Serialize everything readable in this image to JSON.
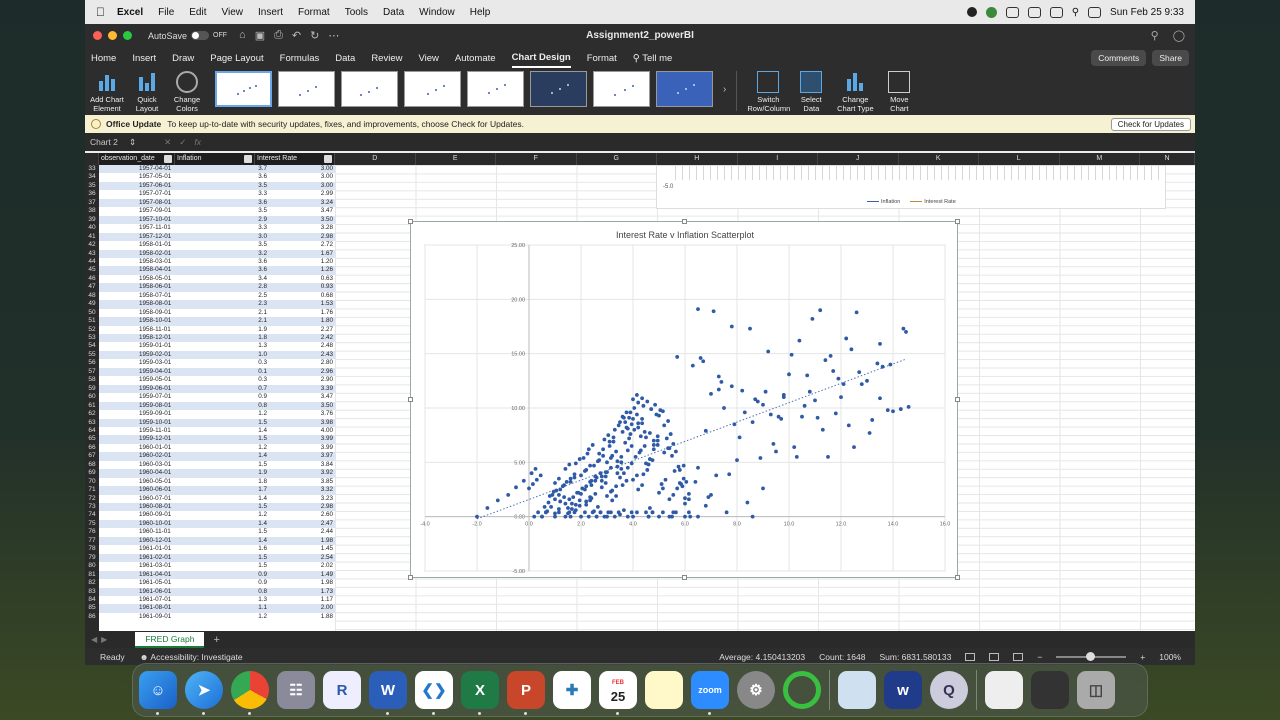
{
  "menubar": {
    "app": "Excel",
    "items": [
      "File",
      "Edit",
      "View",
      "Insert",
      "Format",
      "Tools",
      "Data",
      "Window",
      "Help"
    ],
    "clock": "Sun Feb 25  9:33"
  },
  "titlebar": {
    "autosave_label": "AutoSave",
    "autosave_state": "OFF",
    "title": "Assignment2_powerBI"
  },
  "ribbon_tabs": [
    "Home",
    "Insert",
    "Draw",
    "Page Layout",
    "Formulas",
    "Data",
    "Review",
    "View",
    "Automate",
    "Chart Design",
    "Format"
  ],
  "active_tab": "Chart Design",
  "tell_me": "Tell me",
  "comments_label": "Comments",
  "share_label": "Share",
  "ribbon": {
    "add_chart_element": "Add Chart Element",
    "quick_layout": "Quick Layout",
    "change_colors": "Change Colors",
    "switch_row_column": "Switch Row/Column",
    "select_data": "Select Data",
    "change_chart_type": "Change Chart Type",
    "move_chart": "Move Chart"
  },
  "notification": {
    "title": "Office Update",
    "message": "To keep up-to-date with security updates, fixes, and improvements, choose Check for Updates.",
    "button": "Check for Updates"
  },
  "formula_bar": {
    "name_box": "Chart 2",
    "fx": "fx"
  },
  "columns": {
    "headers": [
      "observation_date",
      "Inflation",
      "Interest Rate",
      "D",
      "E",
      "F",
      "G",
      "H",
      "I",
      "J",
      "K",
      "L",
      "M",
      "N"
    ]
  },
  "table": {
    "start_row": 33,
    "rows": [
      [
        "1957-04-01",
        "3.7",
        "3.00"
      ],
      [
        "1957-05-01",
        "3.6",
        "3.00"
      ],
      [
        "1957-06-01",
        "3.5",
        "3.00"
      ],
      [
        "1957-07-01",
        "3.3",
        "2.99"
      ],
      [
        "1957-08-01",
        "3.6",
        "3.24"
      ],
      [
        "1957-09-01",
        "3.5",
        "3.47"
      ],
      [
        "1957-10-01",
        "2.9",
        "3.50"
      ],
      [
        "1957-11-01",
        "3.3",
        "3.28"
      ],
      [
        "1957-12-01",
        "3.0",
        "2.98"
      ],
      [
        "1958-01-01",
        "3.5",
        "2.72"
      ],
      [
        "1958-02-01",
        "3.2",
        "1.67"
      ],
      [
        "1958-03-01",
        "3.6",
        "1.20"
      ],
      [
        "1958-04-01",
        "3.6",
        "1.26"
      ],
      [
        "1958-05-01",
        "3.4",
        "0.63"
      ],
      [
        "1958-06-01",
        "2.8",
        "0.93"
      ],
      [
        "1958-07-01",
        "2.5",
        "0.68"
      ],
      [
        "1958-08-01",
        "2.3",
        "1.53"
      ],
      [
        "1958-09-01",
        "2.1",
        "1.76"
      ],
      [
        "1958-10-01",
        "2.1",
        "1.80"
      ],
      [
        "1958-11-01",
        "1.9",
        "2.27"
      ],
      [
        "1958-12-01",
        "1.8",
        "2.42"
      ],
      [
        "1959-01-01",
        "1.3",
        "2.48"
      ],
      [
        "1959-02-01",
        "1.0",
        "2.43"
      ],
      [
        "1959-03-01",
        "0.3",
        "2.80"
      ],
      [
        "1959-04-01",
        "0.1",
        "2.96"
      ],
      [
        "1959-05-01",
        "0.3",
        "2.90"
      ],
      [
        "1959-06-01",
        "0.7",
        "3.39"
      ],
      [
        "1959-07-01",
        "0.9",
        "3.47"
      ],
      [
        "1959-08-01",
        "0.8",
        "3.50"
      ],
      [
        "1959-09-01",
        "1.2",
        "3.76"
      ],
      [
        "1959-10-01",
        "1.5",
        "3.98"
      ],
      [
        "1959-11-01",
        "1.4",
        "4.00"
      ],
      [
        "1959-12-01",
        "1.5",
        "3.99"
      ],
      [
        "1960-01-01",
        "1.2",
        "3.99"
      ],
      [
        "1960-02-01",
        "1.4",
        "3.97"
      ],
      [
        "1960-03-01",
        "1.5",
        "3.84"
      ],
      [
        "1960-04-01",
        "1.9",
        "3.92"
      ],
      [
        "1960-05-01",
        "1.8",
        "3.85"
      ],
      [
        "1960-06-01",
        "1.7",
        "3.32"
      ],
      [
        "1960-07-01",
        "1.4",
        "3.23"
      ],
      [
        "1960-08-01",
        "1.5",
        "2.98"
      ],
      [
        "1960-09-01",
        "1.2",
        "2.60"
      ],
      [
        "1960-10-01",
        "1.4",
        "2.47"
      ],
      [
        "1960-11-01",
        "1.5",
        "2.44"
      ],
      [
        "1960-12-01",
        "1.4",
        "1.98"
      ],
      [
        "1961-01-01",
        "1.6",
        "1.45"
      ],
      [
        "1961-02-01",
        "1.5",
        "2.54"
      ],
      [
        "1961-03-01",
        "1.5",
        "2.02"
      ],
      [
        "1961-04-01",
        "0.9",
        "1.49"
      ],
      [
        "1961-05-01",
        "0.9",
        "1.98"
      ],
      [
        "1961-06-01",
        "0.8",
        "1.73"
      ],
      [
        "1961-07-01",
        "1.3",
        "1.17"
      ],
      [
        "1961-08-01",
        "1.1",
        "2.00"
      ],
      [
        "1961-09-01",
        "1.2",
        "1.88"
      ]
    ]
  },
  "line_chart_partial": {
    "y_tick": "-5.0",
    "legend": [
      "Inflation",
      "Interest Rate"
    ]
  },
  "chart_data": {
    "type": "scatter",
    "title": "Interest Rate v Inflation Scatterplot",
    "xlim": [
      -4,
      16
    ],
    "ylim": [
      -5,
      25
    ],
    "x_ticks": [
      "-4.0",
      "-2.0",
      "0.0",
      "2.0",
      "4.0",
      "6.0",
      "8.0",
      "10.0",
      "12.0",
      "14.0",
      "16.0"
    ],
    "y_ticks": [
      "-5.00",
      "0.00",
      "5.00",
      "10.00",
      "15.00",
      "20.00",
      "25.00"
    ],
    "trendline": {
      "style": "dotted linear",
      "from": [
        -2,
        -0.2
      ],
      "to": [
        14.5,
        14.5
      ]
    },
    "points_x": [
      -2.0,
      -1.6,
      -1.2,
      -0.8,
      -0.5,
      -0.2,
      0.0,
      0.1,
      0.3,
      0.5,
      0.7,
      0.9,
      1.0,
      1.2,
      1.3,
      1.4,
      1.5,
      1.6,
      1.7,
      1.8,
      1.9,
      2.0,
      2.1,
      2.2,
      2.3,
      2.4,
      2.5,
      2.6,
      2.7,
      2.8,
      2.9,
      3.0,
      3.1,
      3.2,
      3.3,
      3.4,
      3.5,
      3.6,
      3.7,
      3.8,
      3.9,
      4.0,
      4.1,
      4.2,
      4.3,
      4.4,
      4.5,
      4.6,
      4.8,
      5.0,
      5.2,
      5.4,
      5.6,
      5.8,
      6.0,
      6.2,
      6.5,
      6.8,
      7.2,
      7.6,
      8.0,
      8.4,
      0.5,
      0.8,
      1.0,
      1.2,
      1.4,
      1.6,
      1.8,
      2.0,
      2.2,
      2.4,
      2.6,
      2.8,
      3.0,
      3.2,
      3.4,
      3.6,
      3.8,
      4.0,
      4.2,
      4.5,
      4.8,
      5.1,
      5.4,
      5.7,
      6.0,
      0.2,
      0.6,
      1.0,
      1.4,
      1.8,
      2.2,
      2.6,
      3.0,
      3.4,
      3.8,
      4.2,
      4.6,
      5.0,
      5.4,
      2.4,
      2.7,
      3.1,
      3.5,
      3.9,
      4.3,
      4.7,
      5.2,
      5.8,
      3.2,
      3.6,
      4.0,
      4.4,
      4.8,
      3.8,
      4.2,
      4.6,
      1.5,
      2.0,
      2.5,
      3.0,
      3.5,
      4.0,
      4.5,
      5.0,
      5.5,
      6.0,
      6.5,
      7.0,
      2.2,
      2.8,
      3.3,
      1.0,
      1.6,
      2.3,
      2.9,
      3.7,
      4.9,
      5.3,
      5.7,
      6.3,
      6.7,
      7.3,
      7.8,
      8.3,
      8.8,
      9.2,
      9.6,
      10.0,
      10.4,
      10.8,
      11.2,
      11.6,
      12.0,
      12.4,
      12.8,
      13.2,
      13.6,
      14.0,
      14.4,
      10.2,
      10.6,
      11.0,
      11.4,
      11.8,
      12.2,
      12.6,
      13.0,
      13.4,
      13.8,
      6.6,
      7.0,
      7.4,
      7.8,
      8.2,
      8.6,
      9.0,
      9.4,
      9.8,
      10.3,
      10.7,
      11.1,
      11.5,
      11.9,
      12.3,
      12.7,
      13.1,
      13.5,
      13.9,
      14.3,
      14.5,
      14.6,
      9.8,
      10.5,
      11.3,
      12.5,
      13.5,
      6.5,
      7.1,
      7.5,
      8.5,
      9.1,
      9.7,
      10.1,
      10.9,
      11.7,
      12.1,
      6.8,
      7.3,
      7.9,
      8.7,
      9.3,
      8.1,
      8.9,
      9.5,
      5.5,
      5.9,
      6.4,
      6.9,
      7.7,
      8.6,
      9.0
    ],
    "points_y": [
      0.0,
      0.8,
      1.5,
      2.0,
      2.7,
      3.3,
      2.6,
      4.0,
      3.4,
      0.0,
      0.5,
      2.0,
      3.1,
      1.4,
      2.8,
      4.4,
      0.8,
      3.5,
      1.8,
      4.9,
      2.2,
      3.8,
      5.4,
      1.1,
      6.2,
      2.9,
      4.7,
      0.0,
      5.8,
      3.3,
      7.1,
      4.1,
      6.5,
      2.4,
      8.0,
      5.1,
      3.6,
      9.2,
      6.8,
      4.5,
      7.6,
      10.8,
      5.5,
      8.6,
      6.1,
      3.9,
      7.3,
      4.8,
      6.6,
      2.2,
      5.9,
      1.6,
      4.2,
      3.1,
      1.7,
      0.0,
      4.5,
      1.0,
      3.8,
      0.4,
      5.2,
      1.3,
      0.0,
      1.9,
      0.3,
      2.5,
      1.2,
      3.2,
      0.6,
      2.1,
      4.3,
      1.7,
      3.6,
      2.7,
      5.0,
      1.5,
      4.0,
      2.9,
      6.1,
      3.4,
      8.2,
      4.9,
      7.0,
      3.0,
      6.3,
      2.6,
      1.2,
      0.0,
      0.9,
      1.6,
      0.0,
      1.1,
      2.8,
      0.0,
      1.9,
      4.6,
      0.0,
      2.5,
      0.0,
      9.3,
      0.0,
      3.3,
      5.2,
      6.9,
      8.7,
      9.6,
      7.4,
      9.9,
      8.4,
      4.3,
      5.6,
      7.8,
      9.0,
      10.2,
      6.2,
      8.1,
      10.5,
      0.0,
      0.3,
      0.0,
      0.5,
      0.0,
      0.2,
      0.0,
      0.4,
      0.0,
      0.0,
      0.0,
      0.0,
      2.0,
      1.4,
      3.7,
      0.0,
      0.0,
      0.0,
      0.0,
      0.0,
      8.7,
      9.4,
      7.2,
      14.7,
      13.9,
      14.3,
      12.9,
      12.0,
      9.6,
      10.6,
      15.2,
      9.2,
      13.1,
      16.2,
      11.5,
      19.0,
      14.8,
      11.0,
      15.4,
      12.2,
      8.9,
      13.8,
      9.7,
      17.3,
      6.4,
      10.2,
      10.7,
      14.4,
      9.5,
      16.4,
      18.8,
      12.5,
      14.1,
      9.8,
      14.6,
      11.3,
      12.4,
      17.5,
      11.6,
      8.7,
      10.3,
      6.7,
      11.2,
      5.5,
      13.0,
      9.1,
      5.5,
      12.7,
      8.4,
      13.3,
      7.7,
      10.9,
      14.0,
      9.9,
      17.0,
      10.1,
      11.0,
      9.2,
      8.0,
      6.4,
      15.9,
      19.1,
      18.9,
      10.0,
      17.3,
      11.5,
      9.0,
      14.9,
      18.2,
      13.4,
      12.2,
      7.9,
      11.7,
      8.5,
      10.8,
      9.4,
      7.3,
      5.4,
      6.0,
      5.6,
      2.8,
      3.2,
      1.8,
      3.9,
      0.0,
      2.6,
      1.1,
      1.6
    ]
  },
  "scatter_title": "Interest Rate v Inflation Scatterplot",
  "sheet_tab": "FRED Graph",
  "status": {
    "ready": "Ready",
    "accessibility": "Accessibility: Investigate",
    "average": "Average: 4.150413203",
    "count": "Count: 1648",
    "sum": "Sum: 6831.580133",
    "zoom": "100%"
  },
  "dock": {
    "calendar_month": "FEB",
    "calendar_day": "25",
    "apps": [
      "Finder",
      "Safari",
      "Chrome",
      "Launchpad",
      "R",
      "Word",
      "VS Code",
      "Excel",
      "PowerPoint",
      "Tableau",
      "Calendar",
      "Notes",
      "Zoom",
      "System Settings",
      "Activity",
      "Preview",
      "Webex",
      "QuickTime",
      "Photos",
      "Downloads",
      "Trash"
    ]
  }
}
